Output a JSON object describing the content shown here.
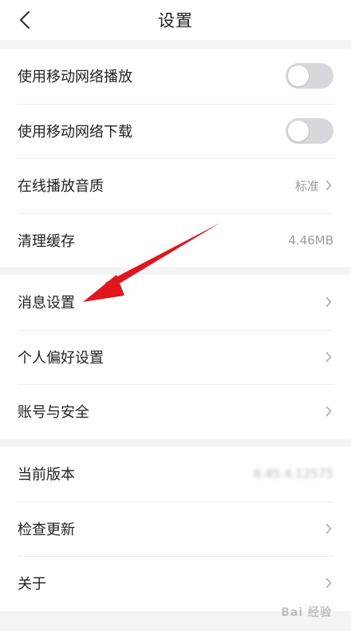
{
  "header": {
    "title": "设置"
  },
  "section1": {
    "items": [
      {
        "label": "使用移动网络播放",
        "toggle_on": false
      },
      {
        "label": "使用移动网络下载",
        "toggle_on": false
      },
      {
        "label": "在线播放音质",
        "value": "标准"
      },
      {
        "label": "清理缓存",
        "value": "4.46MB"
      }
    ]
  },
  "section2": {
    "items": [
      {
        "label": "消息设置"
      },
      {
        "label": "个人偏好设置"
      },
      {
        "label": "账号与安全"
      }
    ]
  },
  "section3": {
    "items": [
      {
        "label": "当前版本",
        "value": "6.45.4.12575"
      },
      {
        "label": "检查更新"
      },
      {
        "label": "关于"
      }
    ]
  },
  "watermark": {
    "text": "Bai 经验"
  },
  "colors": {
    "annotation_arrow": "#e0161c",
    "toggle_off": "#d7d7dc"
  }
}
